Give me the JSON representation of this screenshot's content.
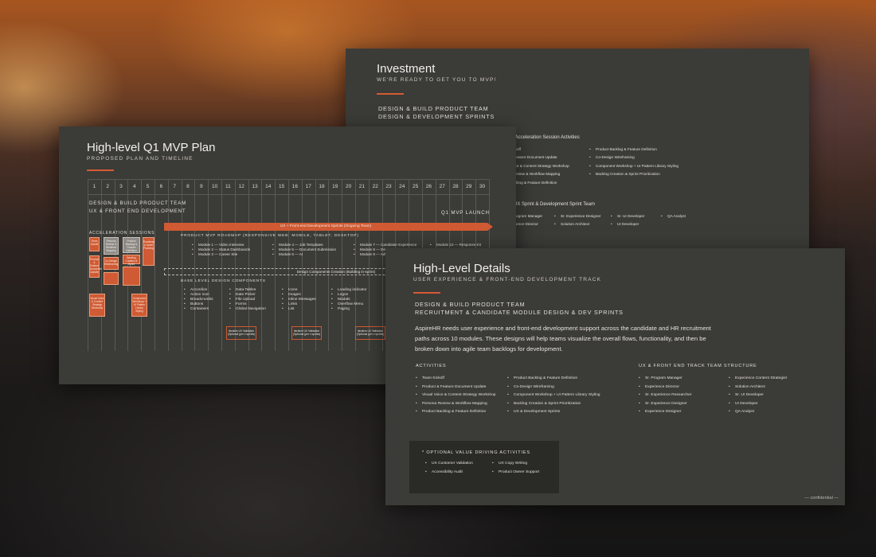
{
  "investment": {
    "title": "Investment",
    "subtitle": "WE'RE READY TO GET YOU TO MVP!",
    "heading1": "DESIGN & BUILD PRODUCT TEAM",
    "heading2": "DESIGN & DEVELOPMENT SPRINTS",
    "activities_heading": "-5 Acceleration Session Activities",
    "col1": [
      "Kickoff",
      "& Feature Document Update",
      "Voice & Content Strategy Workshop",
      "s Review & Workflow Mapping",
      "Backlog & Feature Definition"
    ],
    "col2": [
      "Product Backlog & Feature Definition",
      "Co-Design Wireframing",
      "Component Workshop + UI Pattern Library Styling",
      "Backlog Creation & Sprint Prioritization"
    ],
    "team_heading": "g UX Sprint & Development Sprint Team",
    "team_col1": [
      "ogram Manager",
      "ence Director"
    ],
    "team_col2": [
      "Sr. Experience Designer",
      "Solution Architect"
    ],
    "team_col3": [
      "Sr. UI Developer",
      "UI Developer"
    ],
    "team_col4": [
      "QA Analyst"
    ]
  },
  "plan": {
    "title": "High-level Q1 MVP Plan",
    "subtitle": "PROPOSED PLAN AND TIMELINE",
    "weeks": [
      "1",
      "2",
      "3",
      "4",
      "5",
      "6",
      "7",
      "8",
      "9",
      "10",
      "11",
      "12",
      "13",
      "14",
      "15",
      "16",
      "17",
      "18",
      "19",
      "20",
      "21",
      "22",
      "23",
      "24",
      "25",
      "26",
      "27",
      "28",
      "29",
      "30"
    ],
    "team_line1": "DESIGN & BUILD PRODUCT TEAM",
    "team_line2": "UX & FRONT END DEVELOPMENT",
    "launch": "Q1 MVP LAUNCH",
    "sprint_bar": "UX + Front-end Development Sprints (Ongoing Team)",
    "accel_label": "ACCELERATION SESSIONS",
    "roadmap_heading": "PRODUCT MVP ROADMAP (RESPONSIVE WEB: MOBILE, TABLET, DESKTOP)",
    "roadmap_col1": [
      "Module 1 — Video Interview",
      "Module 2 — Status Dashboards",
      "Module 3 — Career Site"
    ],
    "roadmap_col2": [
      "Module 4 — Job Templates",
      "Module 5 — Document Submission",
      "Module 6 — AI"
    ],
    "roadmap_col3": [
      "Module 7 — Candidate Experience",
      "Module 8 — Dete",
      "Module 9 — Adv"
    ],
    "roadmap_col4": [
      "Module 10 — Response Kit"
    ],
    "components_bar": "Design Components Creation (Building in-sprint)",
    "base_heading": "BASE LEVEL DESIGN COMPONENTS",
    "base_col1": [
      "Accordion",
      "Action Icon",
      "Breadcrumbs",
      "Buttons",
      "Containers"
    ],
    "base_col2": [
      "Data Tables",
      "Date Picker",
      "File Upload",
      "Forms",
      "Global Navigation"
    ],
    "base_col3": [
      "Icons",
      "Images",
      "Inline Messages",
      "Links",
      "List"
    ],
    "base_col4": [
      "Loading indicator",
      "Logos",
      "Modals",
      "Overflow Menu",
      "Paging"
    ],
    "validation_label": "Iterative UX Validation (Optional (per x sprints)",
    "sessions_a": [
      "Team Kickoff",
      "Product & Feature Document Update"
    ],
    "sessions_b": [
      "Persona Review & Workflow Mapping",
      "Co-Design Wireframing"
    ],
    "sessions_c": [
      "Product Backlog & Feature Definition",
      "Backlog Creation & Sprint Prioritization"
    ],
    "sessions_d": [
      "Visual Voice & Content Strategy Workshop",
      "Component Workshop + UI Pattern Library Styling"
    ],
    "sessions_e": [
      "Roadmap & Sprint Planning"
    ]
  },
  "details": {
    "title": "High-Level Details",
    "subtitle": "USER EXPERIENCE & FRONT-END DEVELOPMENT TRACK",
    "heading1": "DESIGN & BUILD PRODUCT TEAM",
    "heading2": "RECRUITMENT & CANDIDATE MODULE DESIGN & DEV SPRINTS",
    "paragraph": "AspireHR needs user experience and front-end development support across the candidate and HR recruitment paths across 10 modules. These designs will help teams visualize the overall flows, functionality, and then be broken down into agile team backlogs for development.",
    "activities_heading": "ACTIVITIES",
    "activities_col1": [
      "Team Kickoff",
      "Product & Feature Document Update",
      "Visual Voice & Content Strategy Workshop",
      "Persona Review & Workflow Mapping",
      "Product Backlog & Feature Definition"
    ],
    "activities_col2": [
      "Product Backlog & Feature Definition",
      "Co-Design Wireframing",
      "Component Workshop + UI Pattern Library Styling",
      "Backlog Creation & Sprint Prioritization",
      "UX & Development Sprints"
    ],
    "team_heading": "UX & FRONT END TRACK TEAM STRUCTURE",
    "team_col1": [
      "Sr. Program Manager",
      "Experience Director",
      "Sr. Experience Researcher",
      "Sr. Experience Designer",
      "Experience Designer"
    ],
    "team_col2": [
      "Experience Content Strategist",
      "Solution Architect",
      "Sr. UI Developer",
      "UI Developer",
      "QA Analyst"
    ],
    "optional_heading": "* OPTIONAL VALUE DRIVING ACTIVITIES",
    "optional_col1": [
      "UX Customer Validation",
      "Accessibility Audit"
    ],
    "optional_col2": [
      "UX Copy Writing",
      "Product Owner Support"
    ],
    "footer": "— confidential —"
  },
  "colors": {
    "accent": "#d65b34",
    "slide": "#3b3b37"
  }
}
